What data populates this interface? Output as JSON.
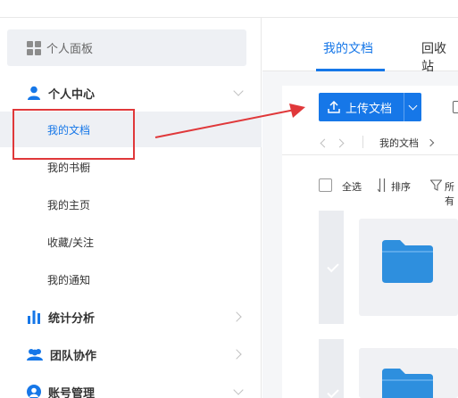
{
  "sidebar": {
    "panel": {
      "label": "个人面板",
      "icon": "grid-icon"
    },
    "personal_center": {
      "label": "个人中心",
      "icon": "user-icon"
    },
    "sub_items": [
      "我的文档",
      "我的书橱",
      "我的主页",
      "收藏/关注",
      "我的通知"
    ],
    "stats": {
      "label": "统计分析",
      "icon": "bar-chart-icon"
    },
    "team": {
      "label": "团队协作",
      "icon": "team-icon"
    },
    "account": {
      "label": "账号管理",
      "icon": "account-icon"
    }
  },
  "main": {
    "tabs": [
      "我的文档",
      "回收站"
    ],
    "upload_label": "上传文档",
    "breadcrumb": "我的文档",
    "toolbar": {
      "select_all": "全选",
      "sort": "排序",
      "filter": "所有"
    }
  },
  "colors": {
    "accent": "#1677e8",
    "highlight_red": "#e0383a",
    "folder": "#2e8fde"
  }
}
